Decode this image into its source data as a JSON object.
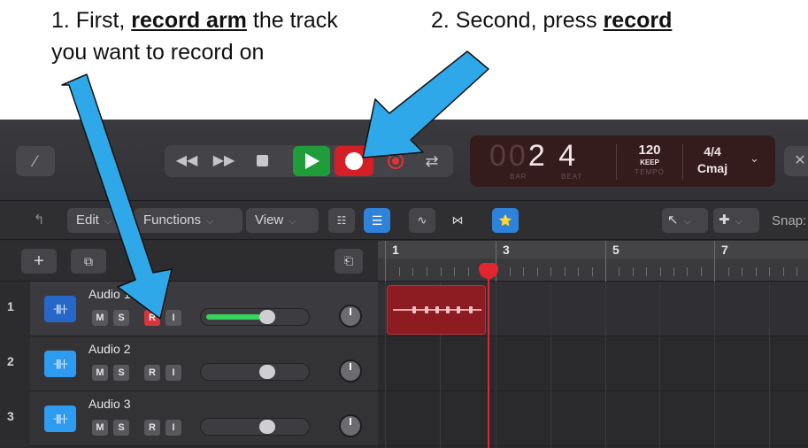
{
  "annotations": {
    "step1_prefix": "1. First, ",
    "step1_emphasis": "record arm",
    "step1_suffix": " the track",
    "step1_line2": "you want to record on",
    "step2_prefix": "2. Second, press ",
    "step2_emphasis": "record",
    "arrow_color": "#2ea8e8"
  },
  "control_bar": {
    "pencil_icon": "pencil-icon",
    "transport": {
      "rewind": "◀◀",
      "fast_forward": "▶▶",
      "cycle": "⇄"
    },
    "lcd": {
      "position_dim": "00",
      "bar": "2",
      "beat": "4",
      "bar_label": "BAR",
      "beat_label": "BEAT",
      "tempo": "120",
      "tempo_mode": "KEEP",
      "tempo_label": "TEMPO",
      "time_signature": "4/4",
      "key": "Cmaj",
      "background": "#351c1c"
    },
    "close_icon": "✕",
    "play_color": "#1f9d3a",
    "record_color": "#d41f26"
  },
  "toolbar": {
    "edit_label": "Edit",
    "functions_label": "Functions",
    "view_label": "View",
    "snap_label": "Snap:",
    "pointer_tool_icon": "↖",
    "marquee_tool_icon": "✚"
  },
  "ruler": {
    "bars": [
      "1",
      "3",
      "5",
      "7"
    ]
  },
  "tracks": [
    {
      "number": "1",
      "name": "Audio 1",
      "mute": "M",
      "solo": "S",
      "record": "R",
      "input": "I",
      "armed": true,
      "fader_level": 0.62
    },
    {
      "number": "2",
      "name": "Audio 2",
      "mute": "M",
      "solo": "S",
      "record": "R",
      "input": "I",
      "armed": false,
      "fader_level": 0.62
    },
    {
      "number": "3",
      "name": "Audio 3",
      "mute": "M",
      "solo": "S",
      "record": "R",
      "input": "I",
      "armed": false,
      "fader_level": 0.62
    }
  ],
  "region": {
    "track": "Audio 1",
    "color": "#8d1b22"
  }
}
